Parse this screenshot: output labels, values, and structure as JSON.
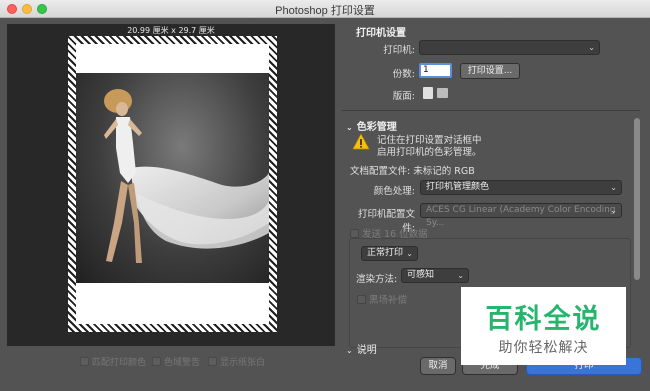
{
  "window": {
    "title": "Photoshop 打印设置"
  },
  "preview": {
    "paper_size": "20.99 厘米 x 29.7 厘米",
    "options": [
      {
        "label": "匹配打印颜色",
        "checked": false
      },
      {
        "label": "色域警告",
        "checked": false
      },
      {
        "label": "显示纸张白",
        "checked": false
      }
    ]
  },
  "printer_setup": {
    "section_title": "打印机设置",
    "printer_label": "打印机:",
    "printer_value": "",
    "copies_label": "份数:",
    "copies_value": "1",
    "print_settings_button": "打印设置...",
    "layout_label": "版面:"
  },
  "color_management": {
    "section_title": "色彩管理",
    "warning_line1": "记住在打印设置对话框中",
    "warning_line2": "启用打印机的色彩管理。",
    "document_profile": "文档配置文件: 未标记的 RGB",
    "color_handling_label": "颜色处理:",
    "color_handling_value": "打印机管理颜色",
    "printer_profile_label": "打印机配置文件:",
    "printer_profile_value": "ACES CG Linear (Academy Color Encoding Sy...",
    "send_16bit_label": "发送 16 位数据",
    "normal_print_value": "正常打印",
    "rendering_intent_label": "渲染方法:",
    "rendering_intent_value": "可感知",
    "black_point_label": "黑场补偿"
  },
  "description": {
    "section_title": "说明"
  },
  "footer": {
    "cancel": "取消",
    "done": "完成",
    "print": "打印"
  },
  "watermark": {
    "title": "百科全说",
    "subtitle": "助你轻松解决"
  },
  "colors": {
    "panel_bg": "#535353",
    "preview_bg": "#282828",
    "primary_button": "#3b74d9",
    "watermark_green": "#27b56d"
  }
}
